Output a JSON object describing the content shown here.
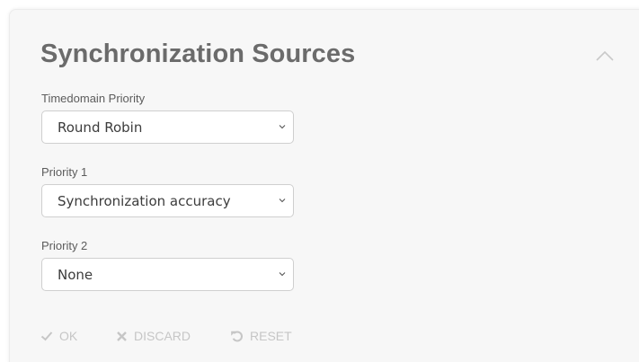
{
  "panel": {
    "title": "Synchronization Sources"
  },
  "fields": {
    "timedomain_priority": {
      "label": "Timedomain Priority",
      "value": "Round Robin"
    },
    "priority_1": {
      "label": "Priority 1",
      "value": "Synchronization accuracy"
    },
    "priority_2": {
      "label": "Priority 2",
      "value": "None"
    }
  },
  "actions": {
    "ok_label": "OK",
    "discard_label": "DISCARD",
    "reset_label": "RESET",
    "enabled": false
  },
  "icons": {
    "collapse": "chevron-up-icon",
    "dropdown": "chevron-down-icon",
    "ok": "check-icon",
    "discard": "x-icon",
    "reset": "undo-icon"
  },
  "colors": {
    "card_background": "#f7f7f7",
    "title": "#6b6b6b",
    "disabled_action": "#c6c6c6"
  }
}
